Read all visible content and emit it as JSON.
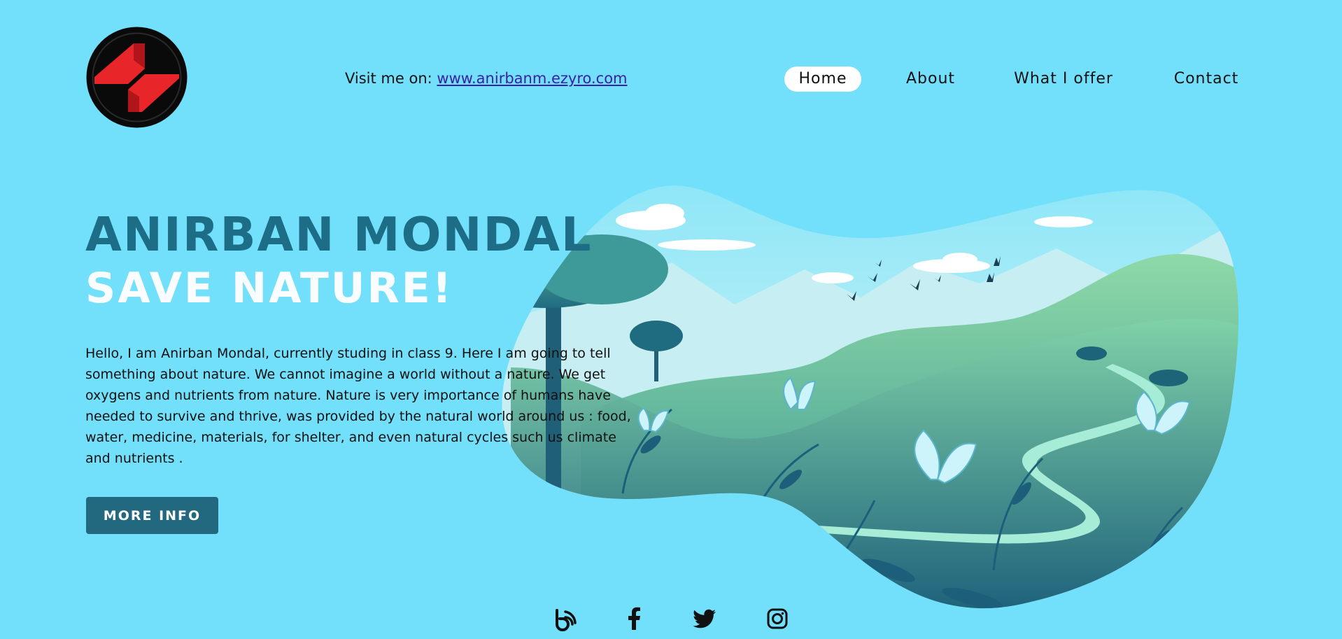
{
  "header": {
    "visit_prefix": "Visit me on:",
    "visit_link": "www.anirbanm.ezyro.com"
  },
  "nav": {
    "items": [
      {
        "label": "Home",
        "active": true
      },
      {
        "label": "About",
        "active": false
      },
      {
        "label": "What I offer",
        "active": false
      },
      {
        "label": "Contact",
        "active": false
      }
    ]
  },
  "hero": {
    "name": "ANIRBAN MONDAL",
    "tagline": "SAVE NATURE!",
    "intro": "Hello, I am Anirban Mondal, currently studing in class 9. Here I am going to tell something about nature. We cannot imagine a world without a nature. We get oxygens and nutrients from nature. Nature is very importance of humans have needed to survive and thrive, was provided by the natural world around us : food, water, medicine, materials, for shelter, and even natural cycles such us climate and nutrients .",
    "button_label": "MORE INFO"
  },
  "social": {
    "icons": [
      "blogger-icon",
      "facebook-icon",
      "twitter-icon",
      "instagram-icon"
    ]
  },
  "colors": {
    "background": "#72dffb",
    "accent": "#22697f",
    "name": "#1e6d86",
    "logo_red": "#e8262a"
  }
}
